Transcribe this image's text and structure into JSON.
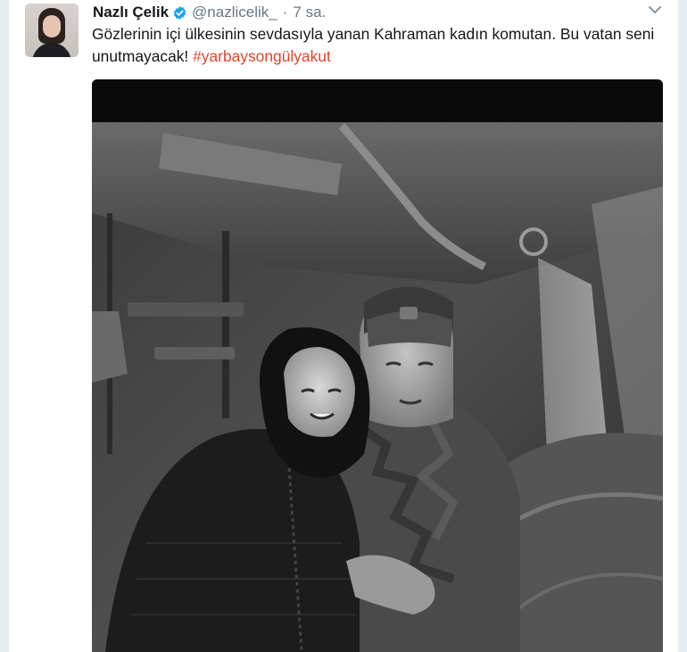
{
  "tweet": {
    "display_name": "Nazlı Çelik",
    "handle": "@nazlicelik_",
    "separator": "·",
    "time": "7 sa.",
    "text_plain": "Gözlerinin içi ülkesinin sevdasıyla yanan Kahraman kadın komutan. Bu vatan seni unutmayacak! ",
    "hashtag": "#yarbaysongülyakut"
  },
  "icons": {
    "verified": "verified-badge-icon",
    "menu": "chevron-down-icon"
  },
  "colors": {
    "hashtag": "#e0452b",
    "verified": "#1da1f2",
    "secondary_text": "#657786",
    "background_frame": "#e6ecf0"
  }
}
